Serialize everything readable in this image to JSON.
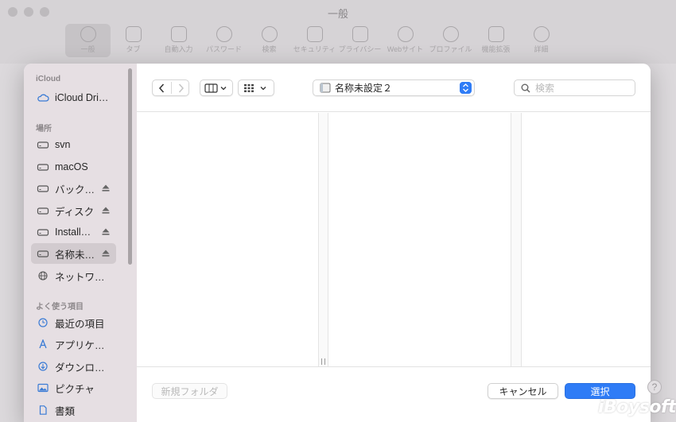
{
  "window": {
    "title": "一般"
  },
  "toolbar": {
    "items": [
      {
        "label": "一般",
        "icon": "gear-icon"
      },
      {
        "label": "タブ",
        "icon": "tabs-icon"
      },
      {
        "label": "自動入力",
        "icon": "autofill-icon"
      },
      {
        "label": "パスワード",
        "icon": "key-icon"
      },
      {
        "label": "検索",
        "icon": "search-icon"
      },
      {
        "label": "セキュリティ",
        "icon": "lock-icon"
      },
      {
        "label": "プライバシー",
        "icon": "hand-icon"
      },
      {
        "label": "Webサイト",
        "icon": "globe-icon"
      },
      {
        "label": "プロファイル",
        "icon": "person-icon"
      },
      {
        "label": "機能拡張",
        "icon": "puzzle-icon"
      },
      {
        "label": "詳細",
        "icon": "gears-icon"
      }
    ]
  },
  "sidebar": {
    "sections": [
      {
        "title": "iCloud",
        "items": [
          {
            "label": "iCloud Dri…",
            "icon": "cloud-icon"
          }
        ]
      },
      {
        "title": "場所",
        "items": [
          {
            "label": "svn",
            "icon": "drive-icon",
            "eject": false
          },
          {
            "label": "macOS",
            "icon": "drive-icon",
            "eject": false
          },
          {
            "label": "バック…",
            "icon": "drive-icon",
            "eject": true
          },
          {
            "label": "ディスク",
            "icon": "drive-icon",
            "eject": true
          },
          {
            "label": "Install…",
            "icon": "drive-icon",
            "eject": true
          },
          {
            "label": "名称未…",
            "icon": "drive-icon",
            "eject": true,
            "selected": true
          },
          {
            "label": "ネットワ…",
            "icon": "network-icon",
            "eject": false
          }
        ]
      },
      {
        "title": "よく使う項目",
        "items": [
          {
            "label": "最近の項目",
            "icon": "clock-icon"
          },
          {
            "label": "アプリケ…",
            "icon": "apps-icon"
          },
          {
            "label": "ダウンロ…",
            "icon": "download-icon"
          },
          {
            "label": "ピクチャ",
            "icon": "pictures-icon"
          },
          {
            "label": "書類",
            "icon": "document-icon"
          }
        ]
      }
    ]
  },
  "content": {
    "path": "名称未設定２",
    "search_placeholder": "検索"
  },
  "footer": {
    "new_folder": "新規フォルダ",
    "cancel": "キャンセル",
    "choose": "選択"
  },
  "colors": {
    "accent": "#2f7cf6",
    "sidebar_bg": "#e6dfe3"
  },
  "watermark": "iBoysoft",
  "help": "?"
}
